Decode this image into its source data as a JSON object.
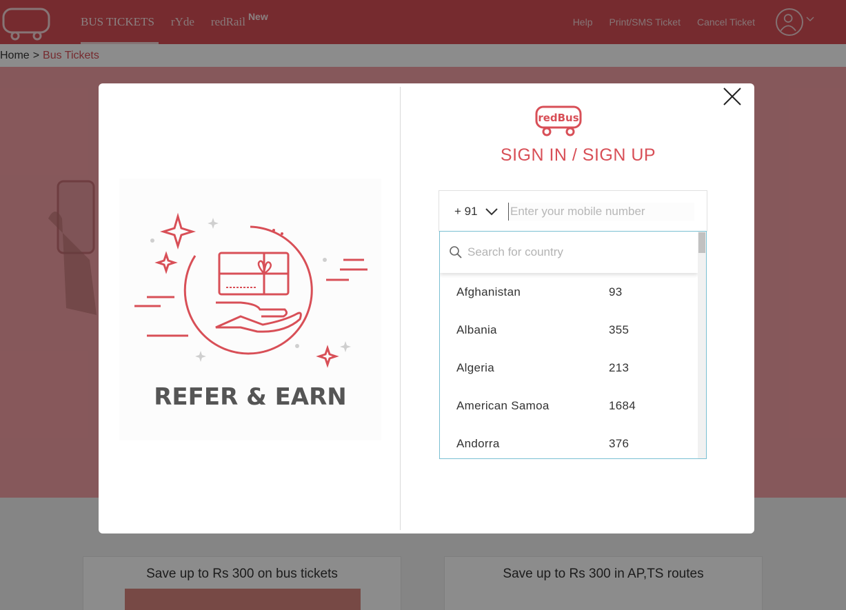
{
  "header": {
    "logo_text": "redBus",
    "nav": [
      {
        "label": "BUS TICKETS"
      },
      {
        "label": "rYde"
      },
      {
        "label": "redRail",
        "badge": "New"
      }
    ],
    "links": [
      "Help",
      "Print/SMS Ticket",
      "Cancel Ticket"
    ],
    "user_icon": "user-circle-icon"
  },
  "breadcrumb": {
    "home": "Home",
    "separator": ">",
    "current": "Bus Tickets"
  },
  "offers": [
    {
      "title": "Save up to Rs 300 on bus tickets"
    },
    {
      "title": "Save up to Rs 300 in AP,TS routes"
    }
  ],
  "modal": {
    "promo_text": "REFER & EARN",
    "logo_text": "redBus",
    "title": "SIGN IN / SIGN UP",
    "phone": {
      "country_code": "+ 91",
      "placeholder": "Enter your mobile number",
      "value": ""
    },
    "country_dropdown": {
      "search_placeholder": "Search for country",
      "countries": [
        {
          "name": "Afghanistan",
          "code": "93"
        },
        {
          "name": "Albania",
          "code": "355"
        },
        {
          "name": "Algeria",
          "code": "213"
        },
        {
          "name": "American Samoa",
          "code": "1684"
        },
        {
          "name": "Andorra",
          "code": "376"
        }
      ]
    }
  },
  "colors": {
    "brand": "#d84f57",
    "dropdown_border": "#79bfd2"
  }
}
